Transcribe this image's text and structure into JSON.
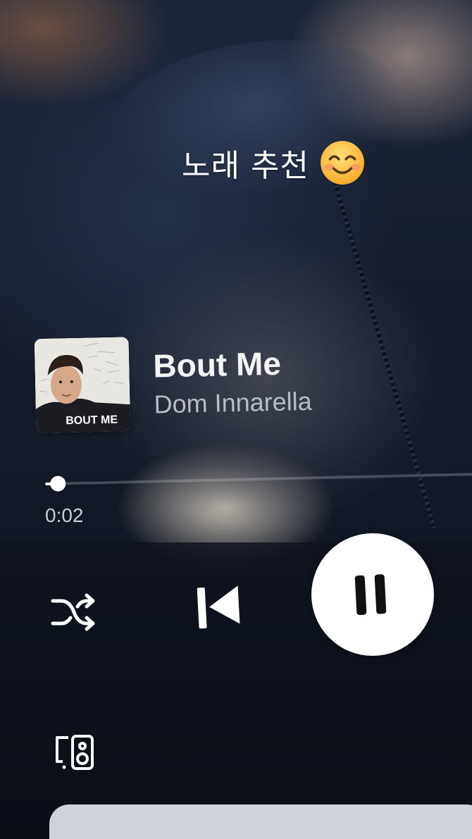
{
  "story": {
    "caption": "노래 추천",
    "caption_emoji": "smiling-face-with-smiling-eyes-icon"
  },
  "player": {
    "album_art_text": "BOUT ME",
    "track_title": "Bout Me",
    "artist": "Dom Innarella",
    "elapsed": "0:02",
    "progress_fraction": 0.02,
    "state": "playing"
  },
  "controls": {
    "shuffle_icon": "shuffle-icon",
    "previous_icon": "skip-previous-icon",
    "play_pause_icon": "pause-icon",
    "device_icon": "connect-device-icon"
  },
  "colors": {
    "primary_text": "#f4f4f4",
    "secondary_text": "#b8bcc4",
    "control": "#ffffff",
    "play_button_bg": "#ffffff",
    "play_button_icon": "#111111"
  }
}
